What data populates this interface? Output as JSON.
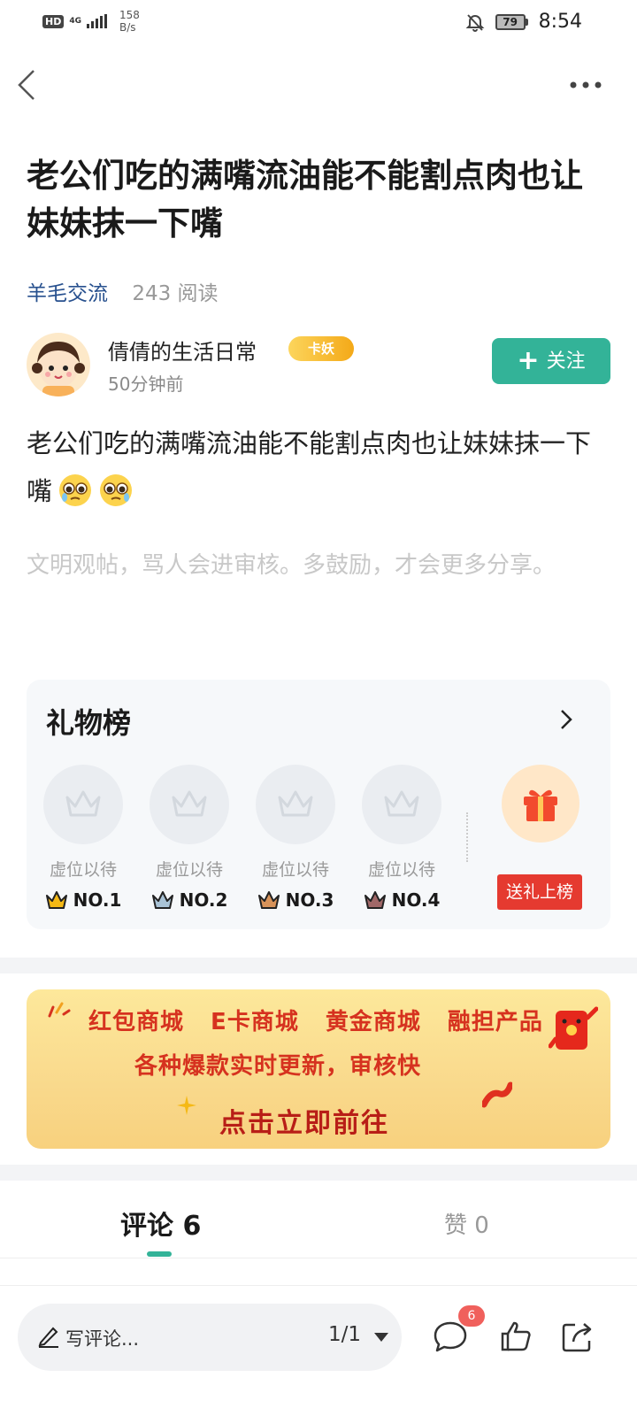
{
  "status_bar": {
    "hd": "HD",
    "network": "4G",
    "speed_value": "158",
    "speed_unit": "B/s",
    "battery": "79",
    "time": "8:54"
  },
  "nav": {
    "back_icon": "chevron-left-icon",
    "more_icon": "more-horizontal-icon"
  },
  "post": {
    "title": "老公们吃的满嘴流油能不能割点肉也让妹妹抹一下嘴",
    "category": "羊毛交流",
    "read_count": "243 阅读",
    "content": "老公们吃的满嘴流油能不能割点肉也让妹妹抹一下嘴",
    "notice": "文明观帖，骂人会进审核。多鼓励，才会更多分享。"
  },
  "author": {
    "name": "倩倩的生活日常",
    "badge": "卡妖",
    "time": "50分钟前",
    "follow_label": "关注"
  },
  "gift_board": {
    "title": "礼物榜",
    "slots": [
      {
        "label": "虚位以待",
        "rank": "NO.1",
        "crown_color": "#f5b915"
      },
      {
        "label": "虚位以待",
        "rank": "NO.2",
        "crown_color": "#a9c3d6"
      },
      {
        "label": "虚位以待",
        "rank": "NO.3",
        "crown_color": "#d8935a"
      },
      {
        "label": "虚位以待",
        "rank": "NO.4",
        "crown_color": "#a06868"
      }
    ],
    "send_label": "送礼上榜"
  },
  "banner": {
    "line1": "红包商城 E卡商城 黄金商城 融担产品",
    "line2": "各种爆款实时更新，审核快",
    "line3": "点击立即前往"
  },
  "tabs": {
    "comments": "评论 6",
    "likes": "赞 0"
  },
  "bottom_bar": {
    "placeholder": "写评论...",
    "page": "1/1",
    "comment_badge": "6"
  },
  "colors": {
    "accent": "#33b398",
    "category": "#27508e",
    "gift_button": "#e53a30"
  }
}
